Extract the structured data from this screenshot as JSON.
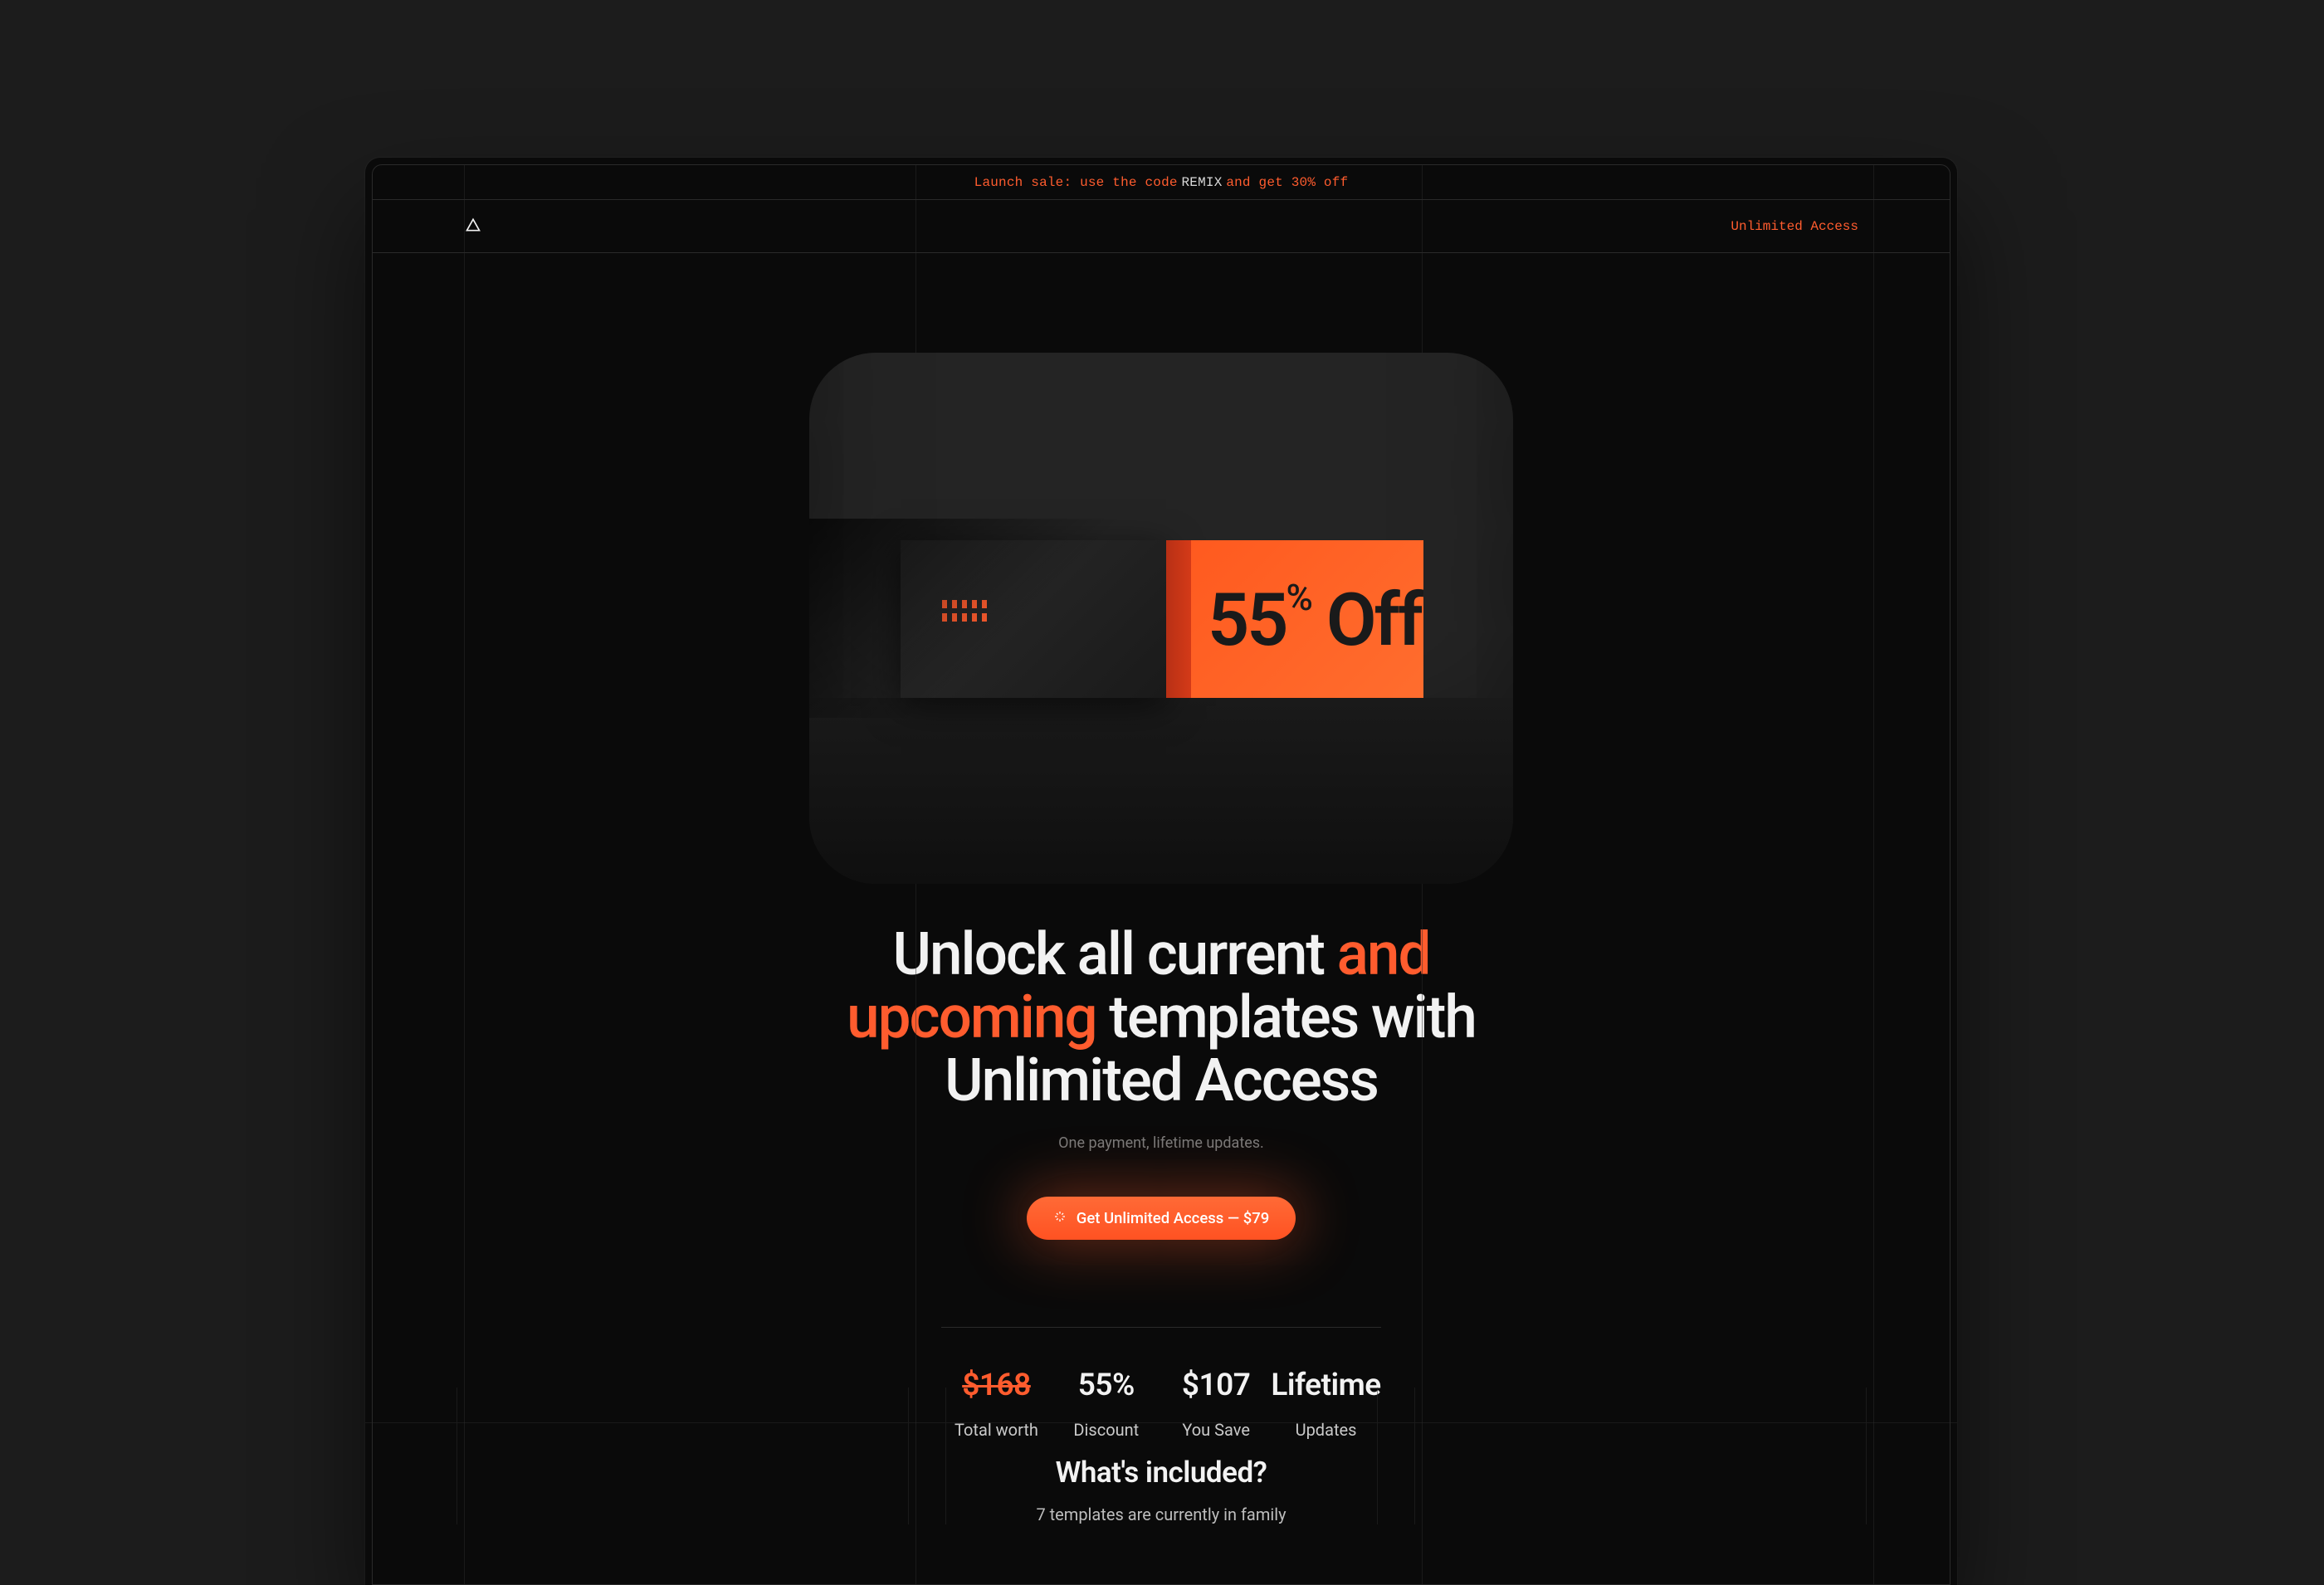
{
  "promo": {
    "prefix": "Launch sale: use the code",
    "code": "REMIX",
    "suffix": "and get 30% off"
  },
  "nav": {
    "cta": "Unlimited Access"
  },
  "hero": {
    "image_badge_number": "55",
    "image_badge_word": "Off",
    "headline_pre": "Unlock all current ",
    "headline_accent": "and upcoming",
    "headline_post": " templates with Unlimited Access",
    "sub": "One payment, lifetime updates.",
    "cta": "Get Unlimited Access — $79"
  },
  "stats": [
    {
      "value": "$168",
      "label": "Total worth",
      "strike": true
    },
    {
      "value": "55%",
      "label": "Discount"
    },
    {
      "value": "$107",
      "label": "You Save"
    },
    {
      "value": "Lifetime",
      "label": "Updates"
    }
  ],
  "included": {
    "title": "What's included?",
    "sub": "7 templates are currently in family"
  },
  "colors": {
    "accent": "#ff5c2e",
    "background": "#0a0a0a"
  }
}
